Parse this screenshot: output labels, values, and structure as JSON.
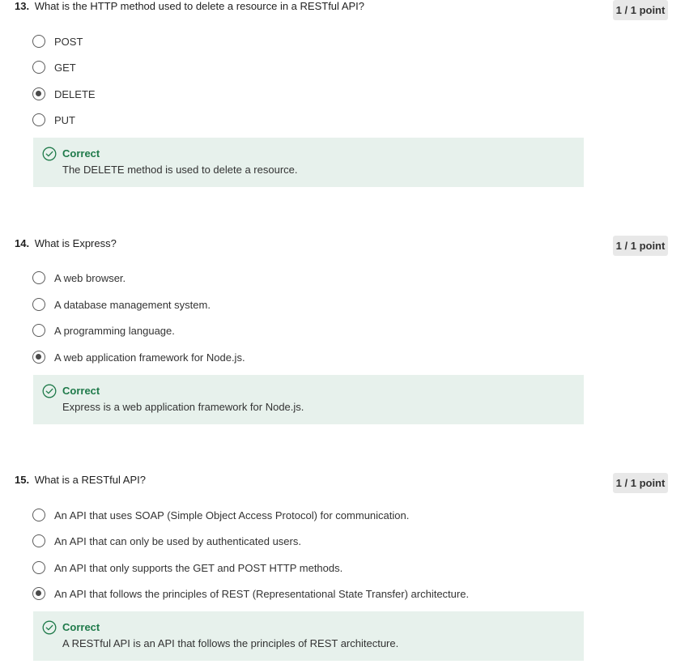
{
  "questions": [
    {
      "number": "13.",
      "text": "What is the HTTP method used to delete a resource in a RESTful API?",
      "points": "1 / 1 point",
      "options": [
        {
          "label": "POST",
          "selected": false
        },
        {
          "label": "GET",
          "selected": false
        },
        {
          "label": "DELETE",
          "selected": true
        },
        {
          "label": "PUT",
          "selected": false
        }
      ],
      "feedback": {
        "status": "Correct",
        "message": "The DELETE method is used to delete a resource."
      }
    },
    {
      "number": "14.",
      "text": "What is Express?",
      "points": "1 / 1 point",
      "options": [
        {
          "label": "A web browser.",
          "selected": false
        },
        {
          "label": "A database management system.",
          "selected": false
        },
        {
          "label": "A programming language.",
          "selected": false
        },
        {
          "label": "A web application framework for Node.js.",
          "selected": true
        }
      ],
      "feedback": {
        "status": "Correct",
        "message": "Express is a web application framework for Node.js."
      }
    },
    {
      "number": "15.",
      "text": "What is a RESTful API?",
      "points": "1 / 1 point",
      "options": [
        {
          "label": "An API that uses SOAP (Simple Object Access Protocol) for communication.",
          "selected": false
        },
        {
          "label": "An API that can only be used by authenticated users.",
          "selected": false
        },
        {
          "label": "An API that only supports the GET and POST HTTP methods.",
          "selected": false
        },
        {
          "label": "An API that follows the principles of REST (Representational State Transfer) architecture.",
          "selected": true
        }
      ],
      "feedback": {
        "status": "Correct",
        "message": "A RESTful API is an API that follows the principles of REST architecture."
      }
    }
  ],
  "icons": {
    "feedback": "check-circle-icon"
  },
  "colors": {
    "correct_text": "#1f7a4a",
    "feedback_bg": "#e7f1ec",
    "badge_bg": "#e8e8e8"
  }
}
